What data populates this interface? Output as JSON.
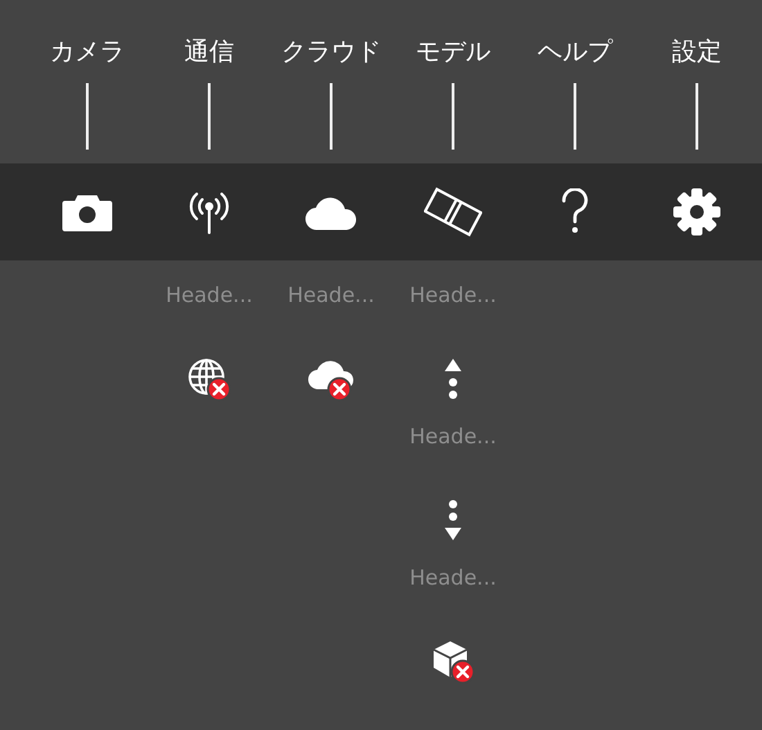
{
  "menu": [
    {
      "label": "カメラ"
    },
    {
      "label": "通信"
    },
    {
      "label": "クラウド"
    },
    {
      "label": "モデル"
    },
    {
      "label": "ヘルプ"
    },
    {
      "label": "設定"
    }
  ],
  "columns": [
    {},
    {
      "items": [
        {
          "kind": "header",
          "text": "Heade..."
        },
        {
          "kind": "network_error"
        }
      ]
    },
    {
      "items": [
        {
          "kind": "header",
          "text": "Heade..."
        },
        {
          "kind": "cloud_error"
        }
      ]
    },
    {
      "items": [
        {
          "kind": "header",
          "text": "Heade..."
        },
        {
          "kind": "upload"
        },
        {
          "kind": "header",
          "text": "Heade..."
        },
        {
          "kind": "download"
        },
        {
          "kind": "header",
          "text": "Heade..."
        },
        {
          "kind": "model_error"
        }
      ]
    },
    {},
    {}
  ]
}
